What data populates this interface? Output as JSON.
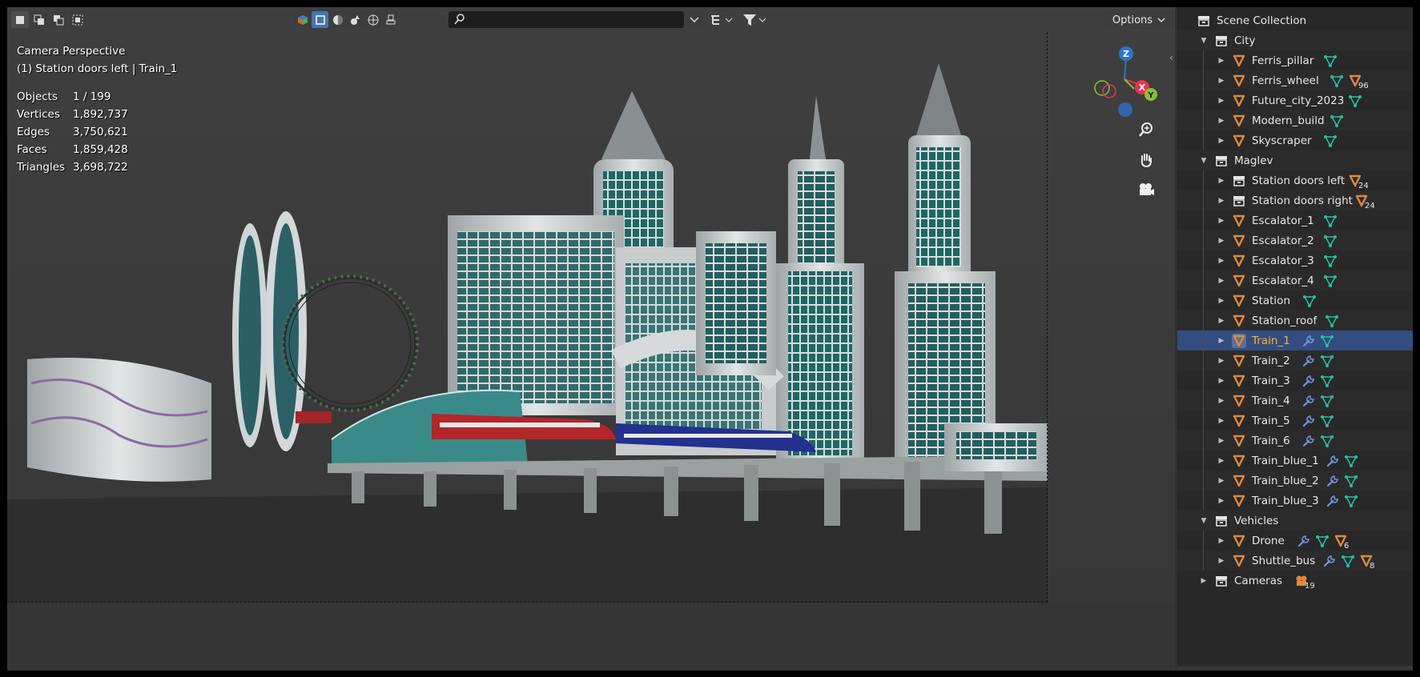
{
  "viewport": {
    "info_title": "Camera Perspective",
    "info_selection": "(1) Station doors left | Train_1",
    "stats": [
      {
        "label": "Objects",
        "value": "1 / 199"
      },
      {
        "label": "Vertices",
        "value": "1,892,737"
      },
      {
        "label": "Edges",
        "value": "3,750,621"
      },
      {
        "label": "Faces",
        "value": "1,859,428"
      },
      {
        "label": "Triangles",
        "value": "3,698,722"
      }
    ],
    "options_label": "Options",
    "search_value": "",
    "axes": {
      "z": "Z",
      "x": "X",
      "y": "Y"
    },
    "colors": {
      "accent": "#4772b3",
      "axis_x": "#e8354f",
      "axis_y": "#8bbd37",
      "axis_z": "#2d74cf"
    }
  },
  "outliner": {
    "root": "Scene Collection",
    "collections": [
      {
        "name": "City",
        "expanded": true,
        "objects": [
          {
            "name": "Ferris_pillar",
            "extras": [
              "mesh"
            ]
          },
          {
            "name": "Ferris_wheel",
            "extras": [
              "mesh",
              "object-badge"
            ],
            "badge": "96"
          },
          {
            "name": "Future_city_2023",
            "extras": [
              "mesh"
            ]
          },
          {
            "name": "Modern_build",
            "extras": [
              "mesh"
            ]
          },
          {
            "name": "Skyscraper",
            "extras": [
              "mesh"
            ]
          }
        ]
      },
      {
        "name": "Maglev",
        "expanded": true,
        "objects": [
          {
            "name": "Station doors left",
            "kind": "collection",
            "extras": [
              "object-badge"
            ],
            "badge": "24"
          },
          {
            "name": "Station doors right",
            "kind": "collection",
            "extras": [
              "object-badge"
            ],
            "badge": "24"
          },
          {
            "name": "Escalator_1",
            "extras": [
              "mesh"
            ]
          },
          {
            "name": "Escalator_2",
            "extras": [
              "mesh"
            ]
          },
          {
            "name": "Escalator_3",
            "extras": [
              "mesh"
            ]
          },
          {
            "name": "Escalator_4",
            "extras": [
              "mesh"
            ]
          },
          {
            "name": "Station",
            "extras": [
              "mesh"
            ]
          },
          {
            "name": "Station_roof",
            "extras": [
              "mesh"
            ]
          },
          {
            "name": "Train_1",
            "extras": [
              "modifier",
              "mesh"
            ],
            "selected": true
          },
          {
            "name": "Train_2",
            "extras": [
              "modifier",
              "mesh"
            ]
          },
          {
            "name": "Train_3",
            "extras": [
              "modifier",
              "mesh"
            ]
          },
          {
            "name": "Train_4",
            "extras": [
              "modifier",
              "mesh"
            ]
          },
          {
            "name": "Train_5",
            "extras": [
              "modifier",
              "mesh"
            ]
          },
          {
            "name": "Train_6",
            "extras": [
              "modifier",
              "mesh"
            ]
          },
          {
            "name": "Train_blue_1",
            "extras": [
              "modifier",
              "mesh"
            ]
          },
          {
            "name": "Train_blue_2",
            "extras": [
              "modifier",
              "mesh"
            ]
          },
          {
            "name": "Train_blue_3",
            "extras": [
              "modifier",
              "mesh"
            ]
          }
        ]
      },
      {
        "name": "Vehicles",
        "expanded": true,
        "objects": [
          {
            "name": "Drone",
            "extras": [
              "modifier",
              "mesh",
              "object-badge"
            ],
            "badge": "6"
          },
          {
            "name": "Shuttle_bus",
            "extras": [
              "modifier",
              "mesh",
              "object-badge"
            ],
            "badge": "8"
          }
        ]
      },
      {
        "name": "Cameras",
        "expanded": false,
        "extras": [
          "camera-badge"
        ],
        "badge": "19",
        "objects": []
      }
    ]
  }
}
